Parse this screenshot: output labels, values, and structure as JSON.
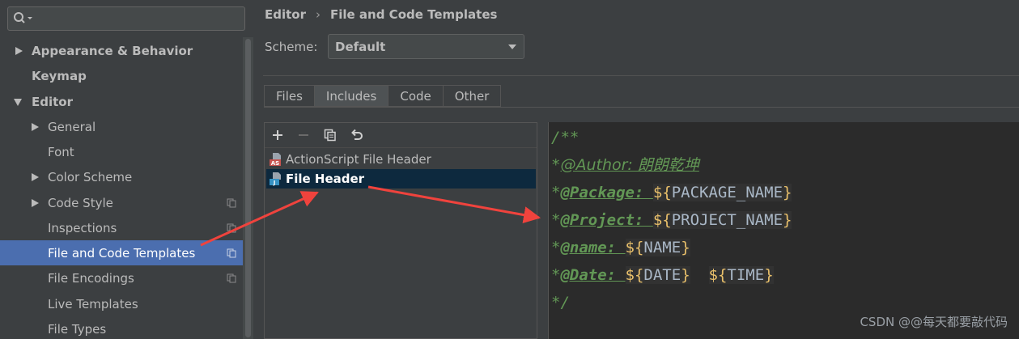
{
  "sidebar": {
    "search_placeholder": "",
    "items": [
      {
        "label": "Appearance & Behavior",
        "expand": "collapsed",
        "bold": true
      },
      {
        "label": "Keymap",
        "expand": "none",
        "bold": true
      },
      {
        "label": "Editor",
        "expand": "expanded",
        "bold": true
      },
      {
        "label": "General",
        "expand": "collapsed"
      },
      {
        "label": "Font",
        "expand": "none"
      },
      {
        "label": "Color Scheme",
        "expand": "collapsed"
      },
      {
        "label": "Code Style",
        "expand": "collapsed",
        "copy_icon": true
      },
      {
        "label": "Inspections",
        "expand": "none",
        "copy_icon": true
      },
      {
        "label": "File and Code Templates",
        "expand": "none",
        "copy_icon": true,
        "selected": true
      },
      {
        "label": "File Encodings",
        "expand": "none",
        "copy_icon": true
      },
      {
        "label": "Live Templates",
        "expand": "none"
      },
      {
        "label": "File Types",
        "expand": "none"
      }
    ]
  },
  "breadcrumb": {
    "parent": "Editor",
    "separator": "›",
    "current": "File and Code Templates"
  },
  "scheme": {
    "label": "Scheme:",
    "value": "Default"
  },
  "tabs": [
    {
      "label": "Files",
      "active": false
    },
    {
      "label": "Includes",
      "active": true
    },
    {
      "label": "Code",
      "active": false
    },
    {
      "label": "Other",
      "active": false
    }
  ],
  "toolbar": {
    "icons": [
      "add-icon",
      "remove-icon",
      "copy-icon",
      "reset-icon"
    ]
  },
  "templates": [
    {
      "label": "ActionScript File Header",
      "icon": "as-file-icon",
      "icon_text": "AS",
      "selected": false
    },
    {
      "label": "File Header",
      "icon": "java-file-icon",
      "icon_text": "J",
      "selected": true
    }
  ],
  "editor": {
    "line1": "/**",
    "line2_star": "*",
    "line2_tag": "@Author: 朗朗乾坤",
    "line3_star": "*",
    "line3_tag": "@Package: ",
    "line3_open": "${",
    "line3_var": "PACKAGE_NAME",
    "line3_close": "}",
    "line4_star": "*",
    "line4_tag": "@Project: ",
    "line4_open": "${",
    "line4_var": "PROJECT_NAME",
    "line4_close": "}",
    "line5_star": "*",
    "line5_tag": "@name: ",
    "line5_open": "${",
    "line5_var": "NAME",
    "line5_close": "}",
    "line6_star": "*",
    "line6_tag": "@Date: ",
    "line6_open1": "${",
    "line6_var1": "DATE",
    "line6_close1": "}",
    "line6_gap": "  ",
    "line6_open2": "${",
    "line6_var2": "TIME",
    "line6_close2": "}",
    "line7": "*/"
  },
  "watermark": "CSDN @@每天都要敲代码",
  "colors": {
    "accent_selection": "#4b6eaf",
    "annotation_arrow": "#f0433d",
    "comment": "#629755"
  }
}
